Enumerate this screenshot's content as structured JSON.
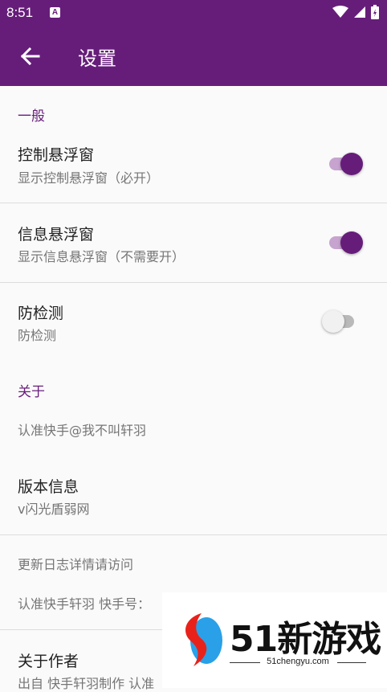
{
  "status_bar": {
    "time": "8:51",
    "notification_icon": "A"
  },
  "app_bar": {
    "title": "设置"
  },
  "general_category": "一般",
  "float_control": {
    "title": "控制悬浮窗",
    "summary": "显示控制悬浮窗（必开）",
    "enabled": true
  },
  "float_info": {
    "title": "信息悬浮窗",
    "summary": "显示信息悬浮窗（不需要开）",
    "enabled": true
  },
  "anti_detect": {
    "title": "防检测",
    "summary": "防检测",
    "enabled": false
  },
  "about_category": "关于",
  "about_follow": "认准快手@我不叫轩羽",
  "version": {
    "title": "版本信息",
    "summary": "v闪光盾弱网"
  },
  "changelog": "更新日志详情请访问",
  "kuaishou": "认准快手轩羽 快手号：",
  "author": {
    "title": "关于作者",
    "summary": "出自 快手轩羽制作 认准"
  },
  "watermark": {
    "text": "51新游戏",
    "url": "51chengyu.com"
  },
  "colors": {
    "primary": "#661d7a",
    "accent_track": "#c6a4cf"
  }
}
